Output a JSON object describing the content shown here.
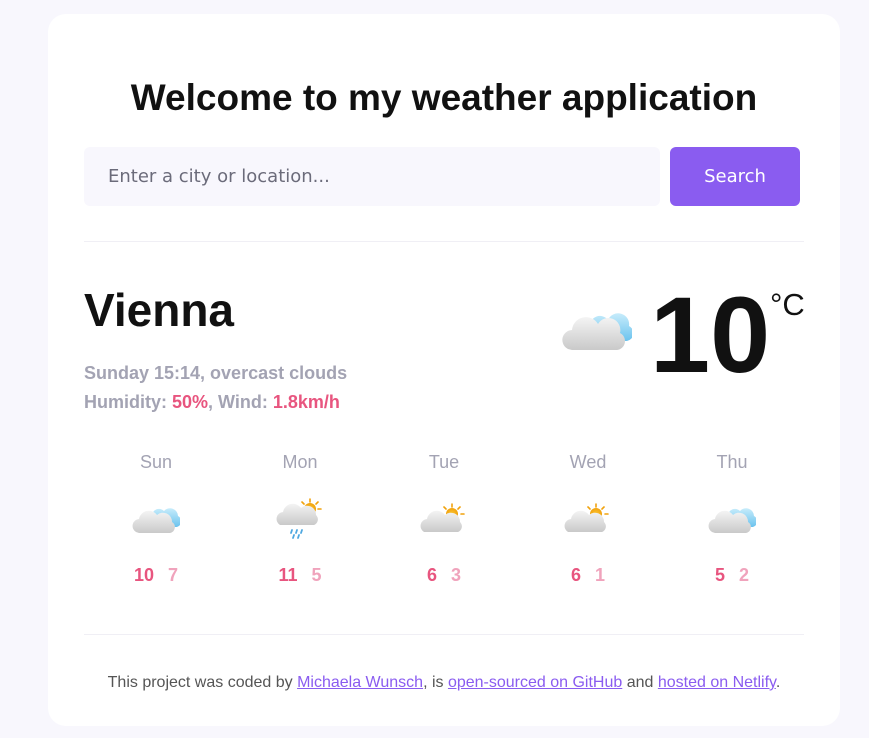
{
  "header": {
    "title": "Welcome to my weather application"
  },
  "search": {
    "placeholder": "Enter a city or location...",
    "value": "",
    "button_label": "Search"
  },
  "current": {
    "city": "Vienna",
    "datetime_description": "Sunday 15:14, overcast clouds",
    "humidity_label": "Humidity: ",
    "humidity_value": "50%",
    "wind_label": ", Wind: ",
    "wind_value": "1.8km/h",
    "temperature": "10",
    "unit": "°C",
    "icon": "overcast-clouds-icon"
  },
  "forecast": [
    {
      "day": "Sun",
      "max": "10",
      "min": "7",
      "icon": "broken-clouds-icon"
    },
    {
      "day": "Mon",
      "max": "11",
      "min": "5",
      "icon": "rain-icon"
    },
    {
      "day": "Tue",
      "max": "6",
      "min": "3",
      "icon": "few-clouds-icon"
    },
    {
      "day": "Wed",
      "max": "6",
      "min": "1",
      "icon": "few-clouds-icon"
    },
    {
      "day": "Thu",
      "max": "5",
      "min": "2",
      "icon": "broken-clouds-icon"
    }
  ],
  "footer": {
    "text_1": "This project was coded by ",
    "author_link": "Michaela Wunsch",
    "text_2": ", is ",
    "github_link": "open-sourced on GitHub",
    "text_3": " and ",
    "netlify_link": "hosted on Netlify",
    "text_4": "."
  },
  "colors": {
    "accent": "#8a5cf0",
    "highlight": "#e8557f",
    "muted": "#a3a3b3"
  }
}
